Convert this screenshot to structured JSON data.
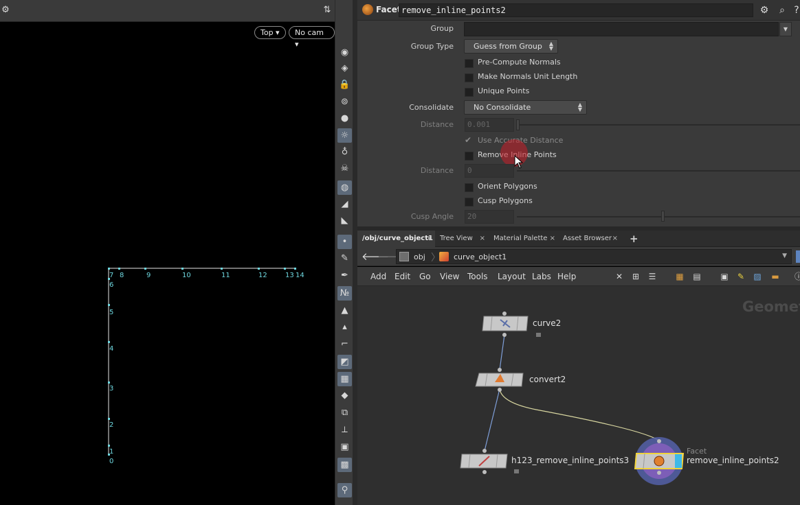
{
  "viewport": {
    "view_button": "Top ▾",
    "camera_button": "No cam ▾",
    "point_numbers": [
      "0",
      "1",
      "2",
      "3",
      "4",
      "5",
      "6",
      "7",
      "8",
      "9",
      "10",
      "11",
      "12",
      "13",
      "14"
    ]
  },
  "parameter_pane": {
    "node_type": "Facet",
    "node_name": "remove_inline_points2",
    "group_label": "Group",
    "group_value": "",
    "group_type_label": "Group Type",
    "group_type_value": "Guess from Group",
    "pre_compute_normals": "Pre-Compute Normals",
    "make_normals_unit_length": "Make Normals Unit Length",
    "unique_points": "Unique Points",
    "consolidate_label": "Consolidate",
    "consolidate_value": "No Consolidate",
    "distance_label_1": "Distance",
    "distance_value_1": "0.001",
    "use_accurate_distance": "Use Accurate Distance",
    "remove_inline_points": "Remove Inline Points",
    "distance_label_2": "Distance",
    "distance_value_2": "0",
    "orient_polygons": "Orient Polygons",
    "cusp_polygons": "Cusp Polygons",
    "cusp_angle_label": "Cusp Angle",
    "cusp_angle_value": "20"
  },
  "tabs": [
    {
      "label": "/obj/curve_object1",
      "active": true
    },
    {
      "label": "Tree View",
      "active": false
    },
    {
      "label": "Material Palette",
      "active": false
    },
    {
      "label": "Asset Browser",
      "active": false
    }
  ],
  "tab_add": "+",
  "path": {
    "segment_1": "obj",
    "segment_2": "curve_object1"
  },
  "network_menu": [
    "Add",
    "Edit",
    "Go",
    "View",
    "Tools",
    "Layout",
    "Labs",
    "Help"
  ],
  "network": {
    "watermark": "Geomet",
    "nodes": [
      {
        "name": "curve2"
      },
      {
        "name": "convert2"
      },
      {
        "name": "h123_remove_inline_points3"
      },
      {
        "name": "remove_inline_points2",
        "type_label": "Facet"
      }
    ]
  },
  "colors": {
    "selected_node_outline": "#f2d43a",
    "display_flag": "#3fb9e8",
    "wire_default": "#7f9fd9",
    "wire_selected": "#d8d6a0",
    "point_color": "#6fd8e0"
  }
}
